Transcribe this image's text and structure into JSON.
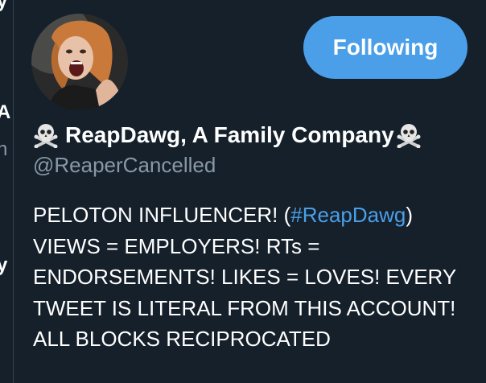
{
  "background": {
    "fragments": [
      "y",
      "A",
      "n",
      "y"
    ]
  },
  "card": {
    "avatar": {
      "icon": "profile-photo-screaming-woman"
    },
    "follow_button": {
      "label": "Following"
    },
    "display_name_emoji": "skull-and-crossbones-icon",
    "display_name": "ReapDawg, A Family Company",
    "handle": "@ReaperCancelled",
    "bio": {
      "prefix": "PELOTON INFLUENCER! (",
      "hashtag": "#ReapDawg",
      "suffix": ") VIEWS = EMPLOYERS! RTs = ENDORSEMENTS! LIKES = LOVES! EVERY TWEET IS LITERAL FROM THIS ACCOUNT! ALL BLOCKS RECIPROCATED"
    }
  },
  "colors": {
    "background": "#15202b",
    "accent": "#4a9fe8",
    "secondary_text": "#8899a6",
    "primary_text": "#ffffff"
  }
}
